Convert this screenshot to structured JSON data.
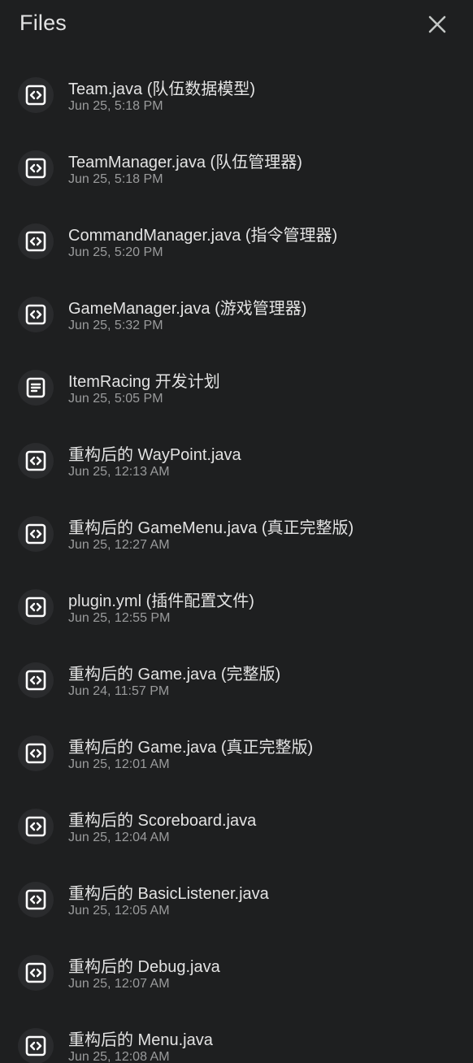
{
  "header": {
    "title": "Files",
    "close_icon": "close-icon"
  },
  "files": [
    {
      "name": "Team.java (队伍数据模型)",
      "date": "Jun 25, 5:18 PM",
      "icon": "code-icon"
    },
    {
      "name": "TeamManager.java (队伍管理器)",
      "date": "Jun 25, 5:18 PM",
      "icon": "code-icon"
    },
    {
      "name": "CommandManager.java (指令管理器)",
      "date": "Jun 25, 5:20 PM",
      "icon": "code-icon"
    },
    {
      "name": "GameManager.java (游戏管理器)",
      "date": "Jun 25, 5:32 PM",
      "icon": "code-icon"
    },
    {
      "name": "ItemRacing 开发计划",
      "date": "Jun 25, 5:05 PM",
      "icon": "document-icon"
    },
    {
      "name": "重构后的 WayPoint.java",
      "date": "Jun 25, 12:13 AM",
      "icon": "code-icon"
    },
    {
      "name": "重构后的 GameMenu.java (真正完整版)",
      "date": "Jun 25, 12:27 AM",
      "icon": "code-icon"
    },
    {
      "name": "plugin.yml (插件配置文件)",
      "date": "Jun 25, 12:55 PM",
      "icon": "code-icon"
    },
    {
      "name": "重构后的 Game.java (完整版)",
      "date": "Jun 24, 11:57 PM",
      "icon": "code-icon"
    },
    {
      "name": "重构后的 Game.java (真正完整版)",
      "date": "Jun 25, 12:01 AM",
      "icon": "code-icon"
    },
    {
      "name": "重构后的 Scoreboard.java",
      "date": "Jun 25, 12:04 AM",
      "icon": "code-icon"
    },
    {
      "name": "重构后的 BasicListener.java",
      "date": "Jun 25, 12:05 AM",
      "icon": "code-icon"
    },
    {
      "name": "重构后的 Debug.java",
      "date": "Jun 25, 12:07 AM",
      "icon": "code-icon"
    },
    {
      "name": "重构后的 Menu.java",
      "date": "Jun 25, 12:08 AM",
      "icon": "code-icon"
    }
  ]
}
